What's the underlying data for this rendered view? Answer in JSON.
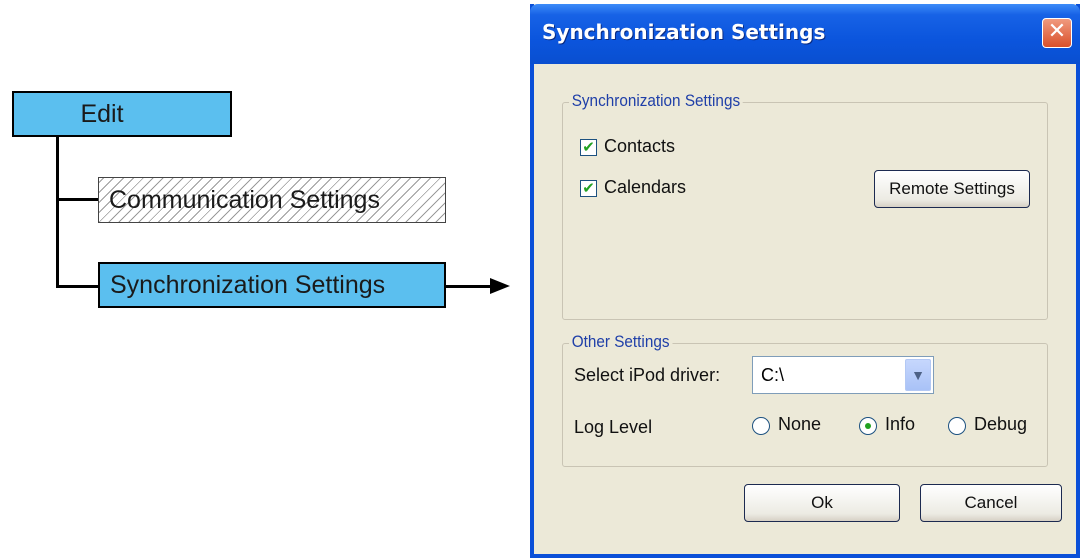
{
  "diagram": {
    "edit_label": "Edit",
    "communication_label": "Communication Settings",
    "synchronization_label": "Synchronization Settings"
  },
  "dialog": {
    "title": "Synchronization Settings",
    "close_glyph": "✕",
    "sync_group": {
      "legend": "Synchronization Settings",
      "contacts": {
        "label": "Contacts",
        "checked": true
      },
      "calendars": {
        "label": "Calendars",
        "checked": true
      },
      "remote_button": "Remote Settings"
    },
    "other_group": {
      "legend": "Other Settings",
      "ipod_label": "Select iPod driver:",
      "ipod_value": "C:\\",
      "log_level_label": "Log Level",
      "log_options": [
        "None",
        "Info",
        "Debug"
      ],
      "log_selected": "Info"
    },
    "ok_button": "Ok",
    "cancel_button": "Cancel"
  },
  "colors": {
    "menu_box": "#5bbfef",
    "title_bar": "#0b55dd",
    "dialog_bg": "#ece9d8",
    "check_green": "#21a121",
    "legend_blue": "#1f3fa8"
  }
}
